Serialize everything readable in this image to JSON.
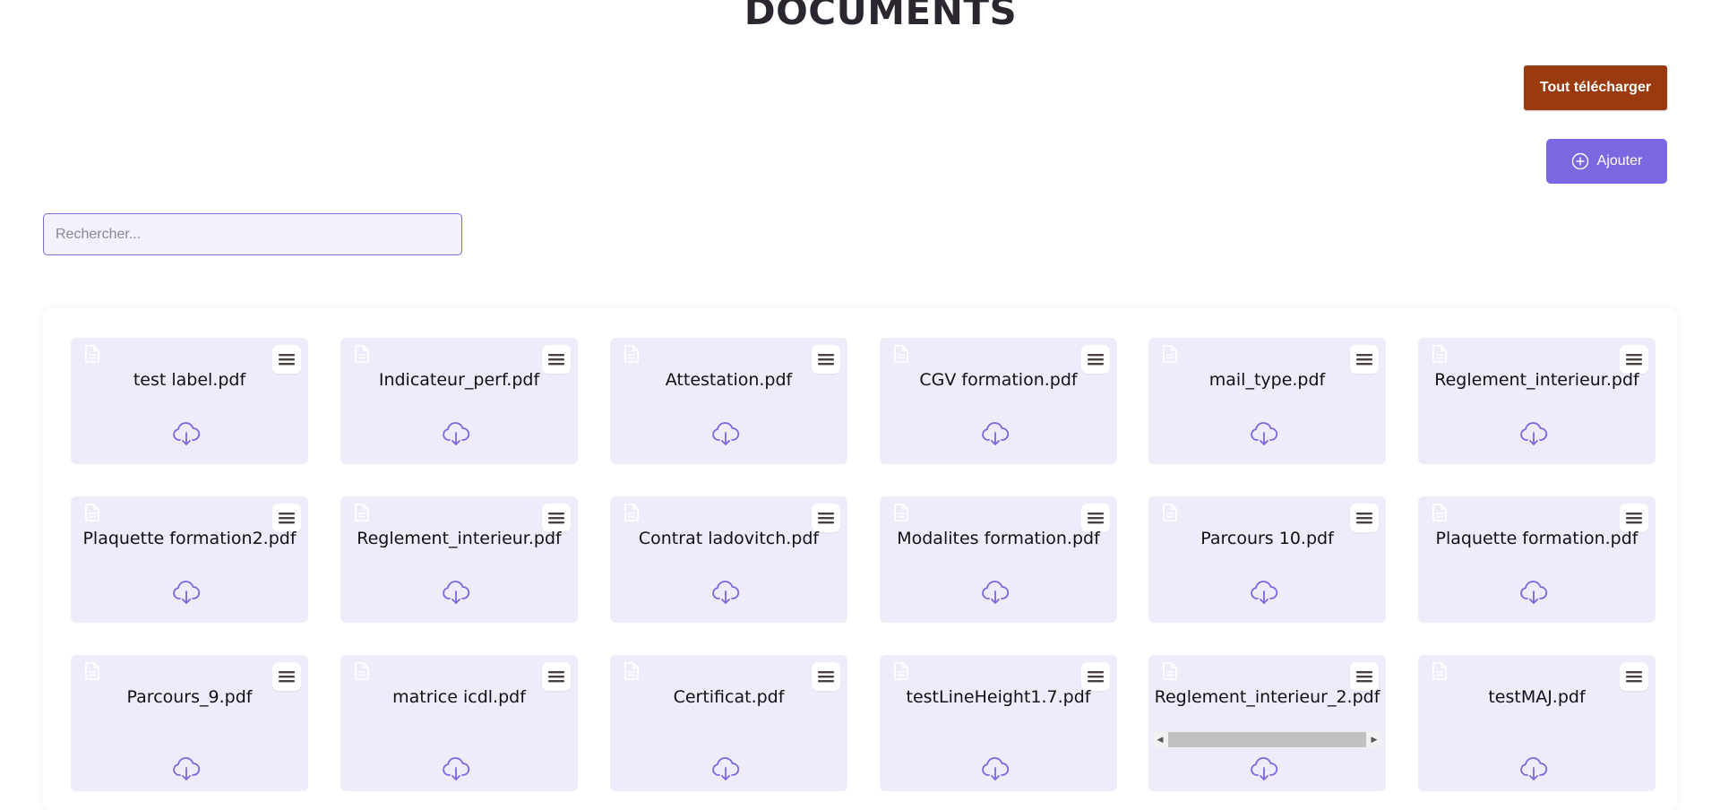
{
  "page": {
    "title": "DOCUMENTS"
  },
  "toolbar": {
    "download_all_label": "Tout télécharger",
    "add_label": "Ajouter",
    "add_icon": "plus-circle-icon"
  },
  "search": {
    "placeholder": "Rechercher...",
    "value": ""
  },
  "colors": {
    "download_all_bg": "#9a3a0f",
    "add_bg": "#7b68e0",
    "card_bg": "#eeecfb",
    "accent": "#7b68e0"
  },
  "documents": [
    {
      "name": "test label.pdf"
    },
    {
      "name": "Indicateur_perf.pdf"
    },
    {
      "name": "Attestation.pdf"
    },
    {
      "name": "CGV formation.pdf"
    },
    {
      "name": "mail_type.pdf"
    },
    {
      "name": "Reglement_interieur.pdf"
    },
    {
      "name": "Plaquette formation2.pdf"
    },
    {
      "name": "Reglement_interieur.pdf"
    },
    {
      "name": "Contrat ladovitch.pdf"
    },
    {
      "name": "Modalites formation.pdf"
    },
    {
      "name": "Parcours 10.pdf"
    },
    {
      "name": "Plaquette formation.pdf"
    },
    {
      "name": "Parcours_9.pdf"
    },
    {
      "name": "matrice icdl.pdf"
    },
    {
      "name": "Certificat.pdf"
    },
    {
      "name": "testLineHeight1.7.pdf"
    },
    {
      "name": "Reglement_interieur_2.pdf",
      "scrollable": true
    },
    {
      "name": "testMAJ.pdf"
    }
  ]
}
